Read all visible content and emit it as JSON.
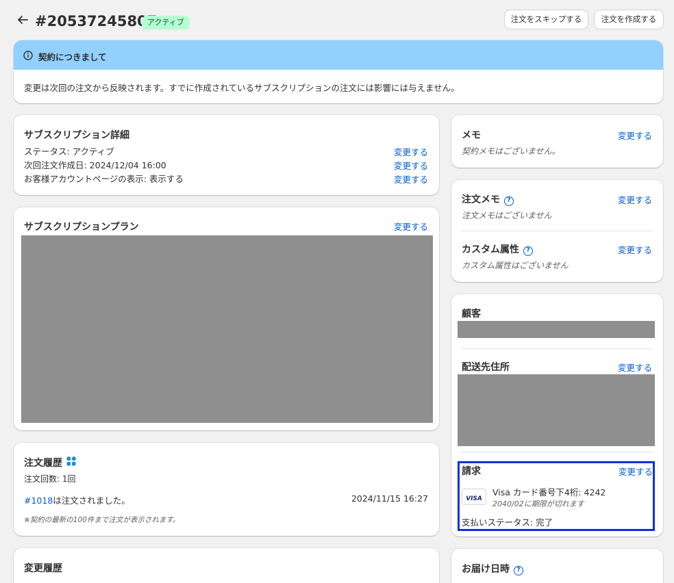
{
  "header": {
    "order_id": "#20537245807",
    "status_badge": "アクティブ",
    "skip_button": "注文をスキップする",
    "create_button": "注文を作成する"
  },
  "banner": {
    "title": "契約につきまして",
    "message": "変更は次回の注文から反映されます。すでに作成されているサブスクリプションの注文には影響には与えません。"
  },
  "details": {
    "title": "サブスクリプション詳細",
    "rows": [
      {
        "text": "ステータス: アクティブ",
        "action": "変更する"
      },
      {
        "text": "次回注文作成日: 2024/12/04 16:00",
        "action": "変更する"
      },
      {
        "text": "お客様アカウントページの表示: 表示する",
        "action": "変更する"
      }
    ]
  },
  "plan": {
    "title": "サブスクリプションプラン",
    "action": "変更する"
  },
  "history": {
    "title": "注文履歴",
    "count": "注文回数: 1回",
    "order_link": "#1018",
    "order_suffix": "は注文されました。",
    "order_date": "2024/11/15 16:27",
    "note": "※契約の最新の100件まで注文が表示されます。"
  },
  "change_history": {
    "title": "変更履歴"
  },
  "memo": {
    "title": "メモ",
    "action": "変更する",
    "empty": "契約メモはございません。"
  },
  "order_memo": {
    "title": "注文メモ",
    "action": "変更する",
    "empty": "注文メモはございません"
  },
  "custom_attrs": {
    "title": "カスタム属性",
    "action": "変更する",
    "empty": "カスタム属性はございません"
  },
  "customer": {
    "title": "顧客"
  },
  "shipping": {
    "title": "配送先住所",
    "action": "変更する"
  },
  "billing": {
    "title": "請求",
    "action": "変更する",
    "card_brand": "VISA",
    "card_text": "Visa カード番号下4桁: 4242",
    "expiry": "2040/02に期限が切れます",
    "payment_status": "支払いステータス: 完了"
  },
  "delivery": {
    "title": "お届け日時"
  },
  "colors": {
    "banner_bg": "#91d0ff",
    "badge_bg": "#b4fed2",
    "link": "#005bd3",
    "highlight": "#0a2fe0"
  },
  "icons": [
    "back-arrow-icon",
    "info-icon",
    "help-icon",
    "apps-icon"
  ]
}
